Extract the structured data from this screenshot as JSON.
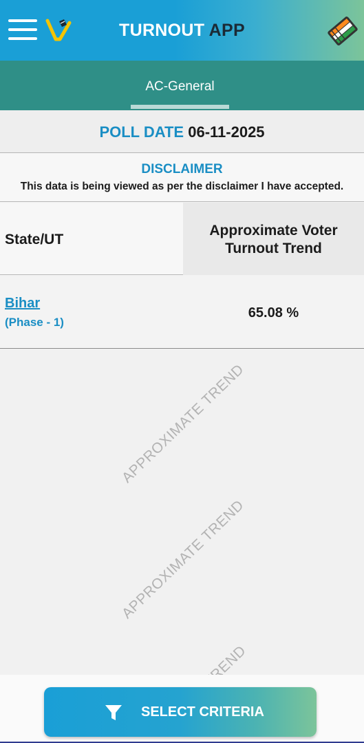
{
  "app": {
    "title_part1": "TURNOUT",
    "title_part2": "APP",
    "icons": {
      "menu": "menu-icon",
      "logo": "voter-v-logo-icon",
      "evm": "evm-machine-icon"
    }
  },
  "tabs": [
    {
      "label": "AC-General",
      "active": true
    }
  ],
  "poll": {
    "label": "POLL DATE",
    "date": "06-11-2025"
  },
  "disclaimer": {
    "title": "DISCLAIMER",
    "text": "This data is being viewed as per the disclaimer I have accepted."
  },
  "table": {
    "headers": {
      "state": "State/UT",
      "turnout_line1": "Approximate Voter",
      "turnout_line2": "Turnout Trend"
    },
    "rows": [
      {
        "state": "Bihar",
        "phase": "(Phase - 1)",
        "turnout": "65.08 %"
      }
    ]
  },
  "watermark": {
    "text": "APPROXIMATE TREND",
    "partial_text": "TREND"
  },
  "bottom": {
    "button_label": "SELECT CRITERIA",
    "icon": "filter-icon"
  },
  "colors": {
    "accent_blue": "#1a8ec4",
    "header_gradient_start": "#1a9fd6",
    "header_gradient_end": "#7cc49a",
    "tab_bar": "#2f8f87"
  }
}
